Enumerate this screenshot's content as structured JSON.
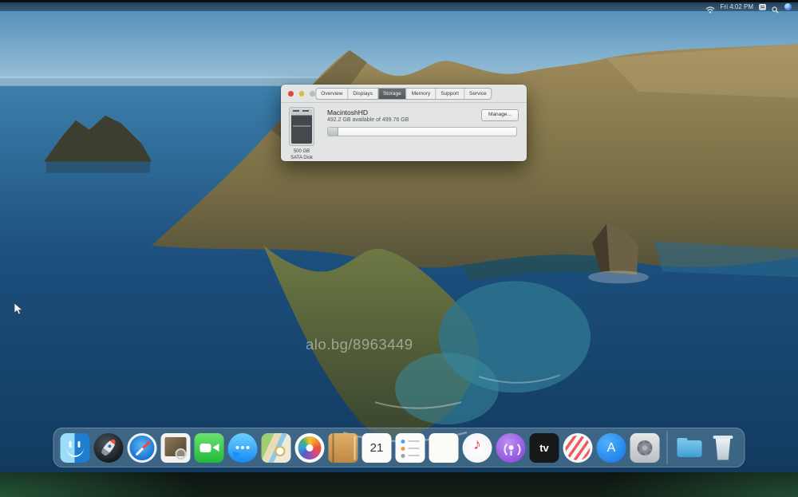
{
  "menu_bar": {
    "clock": "Fri 4:02 PM",
    "icons": [
      "wifi-icon",
      "input-menu-icon",
      "spotlight-search-icon",
      "siri-icon"
    ]
  },
  "about_window": {
    "tabs": [
      {
        "label": "Overview",
        "active": false
      },
      {
        "label": "Displays",
        "active": false
      },
      {
        "label": "Storage",
        "active": true
      },
      {
        "label": "Memory",
        "active": false
      },
      {
        "label": "Support",
        "active": false
      },
      {
        "label": "Service",
        "active": false
      }
    ],
    "disk": {
      "name": "MacintoshHD",
      "availability": "492.2 GB available of 499.76 GB",
      "capacity": "500 GB",
      "kind": "SATA Disk",
      "used_style": "width:5%"
    },
    "manage_button": "Manage..."
  },
  "watermark": "alo.bg/8963449",
  "dock": {
    "items": [
      "finder",
      "launchpad",
      "safari",
      "preview",
      "facetime",
      "messages",
      "maps",
      "photos",
      "contacts",
      "calendar",
      "reminders",
      "notes",
      "music",
      "podcasts",
      "tv",
      "news",
      "app-store",
      "system-preferences",
      "downloads-folder",
      "trash"
    ],
    "calendar_day": "21",
    "tv_label": "tv",
    "appstore_label": "A",
    "music_glyph": "♪"
  },
  "colors": {
    "active_tab": "#53585c",
    "traffic_red": "#e1493f",
    "traffic_yellow": "#d9bb41",
    "dock_tint": "rgba(110,150,175,0.45)",
    "sky_top": "#4d8cba",
    "sea_deep": "#123a5f"
  }
}
